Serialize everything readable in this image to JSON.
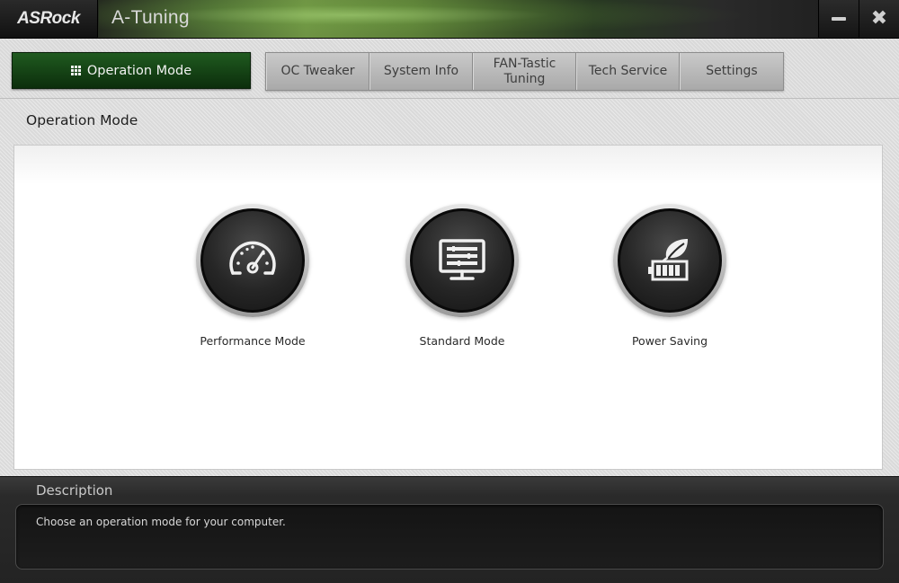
{
  "window": {
    "logo": "ASRock",
    "title": "A-Tuning",
    "minimize_icon": "minimize-icon",
    "close_icon": "close-icon"
  },
  "nav": {
    "active_tab": {
      "label": "Operation Mode",
      "icon": "grid-icon"
    },
    "tabs": [
      {
        "label": "OC Tweaker"
      },
      {
        "label": "System Info"
      },
      {
        "label": "FAN-Tastic\nTuning"
      },
      {
        "label": "Tech Service"
      },
      {
        "label": "Settings"
      }
    ]
  },
  "main": {
    "section_title": "Operation Mode",
    "modes": [
      {
        "label": "Performance Mode",
        "icon": "speedometer-icon"
      },
      {
        "label": "Standard Mode",
        "icon": "monitor-icon"
      },
      {
        "label": "Power Saving",
        "icon": "leaf-battery-icon"
      }
    ]
  },
  "description": {
    "title": "Description",
    "text": "Choose an operation mode for your computer."
  }
}
